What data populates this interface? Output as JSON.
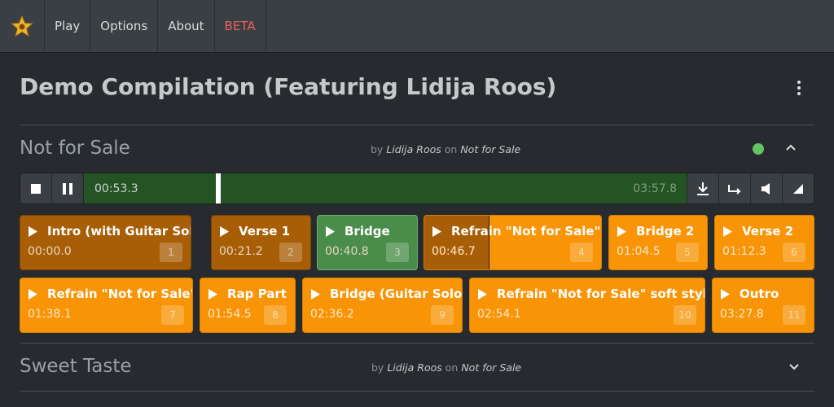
{
  "nav": {
    "items": [
      "Play",
      "Options",
      "About",
      "BETA"
    ]
  },
  "page": {
    "title": "Demo Compilation (Featuring Lidija Roos)"
  },
  "tracks": [
    {
      "title": "Not for Sale",
      "by_prefix": "by",
      "artist": "Lidija Roos",
      "on_word": "on",
      "album": "Not for Sale",
      "status_color": "#62c462",
      "expanded": true
    },
    {
      "title": "Sweet Taste",
      "by_prefix": "by",
      "artist": "Lidija Roos",
      "on_word": "on",
      "album": "Not for Sale",
      "expanded": false
    }
  ],
  "player": {
    "current_time": "00:53.3",
    "total_time": "03:57.8",
    "progress": 0.227
  },
  "segments": [
    {
      "label": "Intro (with Guitar Solo)",
      "time": "00:00.0",
      "num": "1",
      "state": "played"
    },
    {
      "label": "Verse 1",
      "time": "00:21.2",
      "num": "2",
      "state": "played"
    },
    {
      "label": "Bridge",
      "time": "00:40.8",
      "num": "3",
      "state": "active"
    },
    {
      "label": "Refrain \"Not for Sale\"",
      "time": "00:46.7",
      "num": "4",
      "state": "partial",
      "played_fraction": 0.37
    },
    {
      "label": "Bridge 2",
      "time": "01:04.5",
      "num": "5",
      "state": "upcoming"
    },
    {
      "label": "Verse 2",
      "time": "01:12.3",
      "num": "6",
      "state": "upcoming"
    },
    {
      "label": "Refrain \"Not for Sale\"",
      "time": "01:38.1",
      "num": "7",
      "state": "upcoming"
    },
    {
      "label": "Rap Part",
      "time": "01:54.5",
      "num": "8",
      "state": "upcoming"
    },
    {
      "label": "Bridge (Guitar Solo)",
      "time": "02:36.2",
      "num": "9",
      "state": "upcoming"
    },
    {
      "label": "Refrain \"Not for Sale\" soft style",
      "time": "02:54.1",
      "num": "10",
      "state": "upcoming"
    },
    {
      "label": "Outro",
      "time": "03:27.8",
      "num": "11",
      "state": "upcoming"
    }
  ],
  "colors": {
    "segment": "#f89406",
    "segment_played": "#a85e06",
    "segment_active": "#4a8c4a",
    "progress": "#245424",
    "beta": "#ee5f5b"
  }
}
